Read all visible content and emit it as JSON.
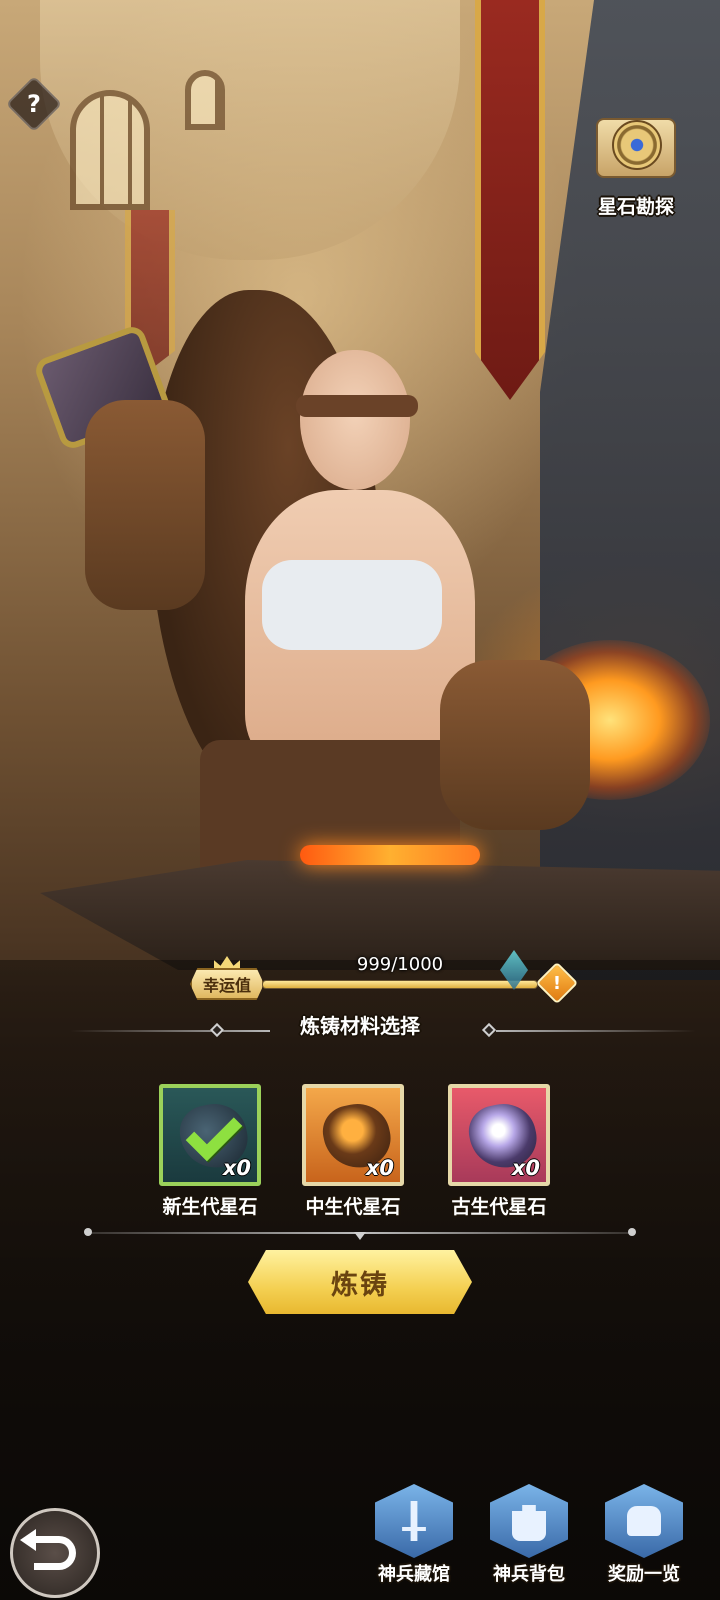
{
  "help": {
    "label": "?"
  },
  "explore": {
    "label": "星石勘探",
    "icon": "compass-scroll-icon"
  },
  "luck": {
    "label": "幸运值",
    "value_text": "999/1000",
    "current": 999,
    "max": 1000,
    "fill_fraction": 0.999,
    "alert": "!"
  },
  "section": {
    "title": "炼铸材料选择"
  },
  "materials": [
    {
      "name": "新生代星石",
      "count": "x0",
      "selected": true
    },
    {
      "name": "中生代星石",
      "count": "x0",
      "selected": false
    },
    {
      "name": "古生代星石",
      "count": "x0",
      "selected": false
    }
  ],
  "forge_button": {
    "label": "炼铸"
  },
  "nav": [
    {
      "label": "神兵藏馆",
      "icon": "armory-icon"
    },
    {
      "label": "神兵背包",
      "icon": "backpack-icon"
    },
    {
      "label": "奖励一览",
      "icon": "reward-chest-icon"
    }
  ],
  "colors": {
    "accent_gold": "#f4d052",
    "selected_border": "#9bd15a",
    "nav_blue": "#3a6aa8"
  }
}
